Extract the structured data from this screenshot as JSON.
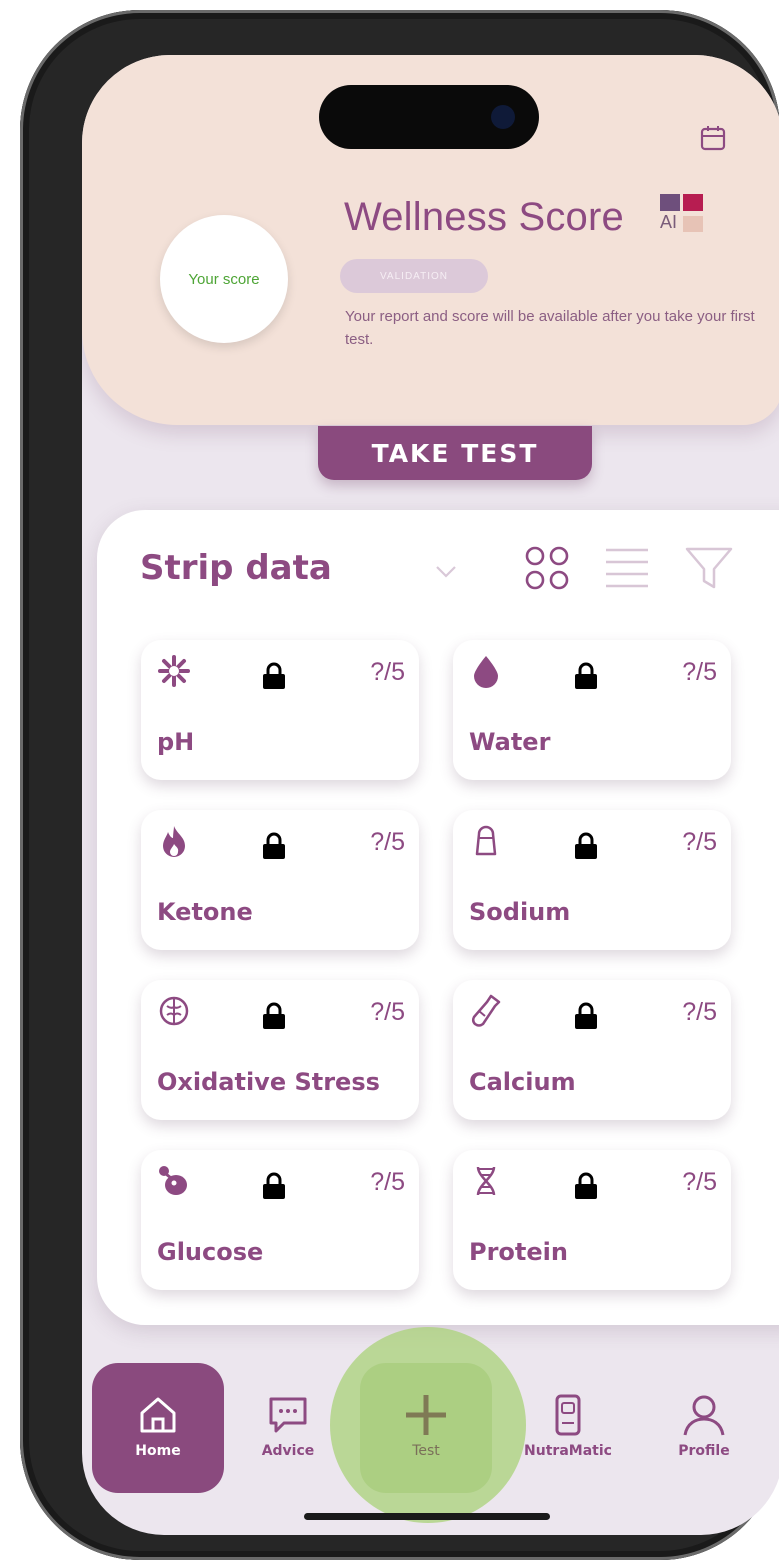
{
  "header": {
    "your_score_label": "Your score",
    "title": "Wellness Score",
    "logo_text": "AI",
    "status_pill": "VALIDATION",
    "report_text": "Your report and score will be available after you take your first test."
  },
  "take_test_label": "TAKE TEST",
  "strip_data": {
    "title": "Strip data",
    "tiles": [
      {
        "name": "pH",
        "score": "?/5",
        "icon": "ph-icon"
      },
      {
        "name": "Water",
        "score": "?/5",
        "icon": "water-drop-icon"
      },
      {
        "name": "Ketone",
        "score": "?/5",
        "icon": "flame-icon"
      },
      {
        "name": "Sodium",
        "score": "?/5",
        "icon": "salt-shaker-icon"
      },
      {
        "name": "Oxidative Stress",
        "score": "?/5",
        "icon": "brain-icon"
      },
      {
        "name": "Calcium",
        "score": "?/5",
        "icon": "milk-bottle-icon"
      },
      {
        "name": "Glucose",
        "score": "?/5",
        "icon": "glucose-icon"
      },
      {
        "name": "Protein",
        "score": "?/5",
        "icon": "dna-icon"
      }
    ]
  },
  "nav": {
    "home": "Home",
    "advice": "Advice",
    "test": "Test",
    "nutramatic": "NutraMatic",
    "profile": "Profile"
  },
  "colors": {
    "brand_purple": "#8d4a82",
    "header_bg": "#f3e1d8",
    "screen_bg": "#ece6ee",
    "score_green": "#4ea536",
    "highlight_green": "#aad278"
  }
}
